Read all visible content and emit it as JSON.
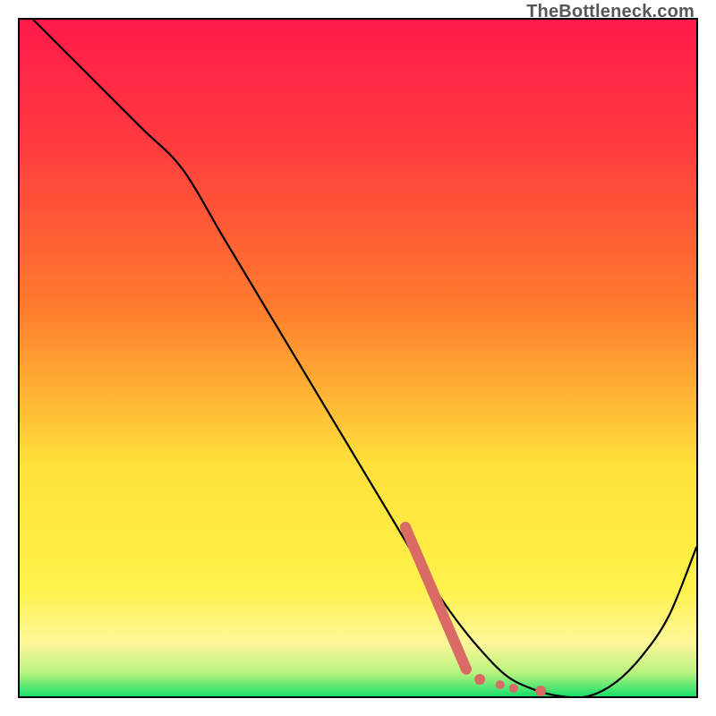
{
  "watermark": "TheBottleneck.com",
  "chart_data": {
    "type": "line",
    "title": "",
    "xlabel": "",
    "ylabel": "",
    "xlim": [
      0,
      100
    ],
    "ylim": [
      0,
      100
    ],
    "grid": false,
    "legend": false,
    "series": [
      {
        "name": "curve",
        "color": "#000000",
        "x": [
          0,
          4,
          10,
          18,
          24,
          30,
          36,
          42,
          48,
          54,
          60,
          64,
          68,
          72,
          76,
          80,
          84,
          88,
          92,
          96,
          100
        ],
        "y": [
          102,
          98,
          92,
          84,
          78,
          68,
          58,
          48,
          38,
          28,
          18,
          12,
          7,
          3,
          1,
          0,
          0,
          2,
          6,
          12,
          22
        ]
      }
    ],
    "highlight": {
      "color": "#d96a66",
      "segment_start": {
        "x": 57,
        "y": 25
      },
      "segment_end": {
        "x": 66,
        "y": 4
      },
      "dots": [
        {
          "x": 68,
          "y": 2.5
        },
        {
          "x": 71,
          "y": 1.7
        },
        {
          "x": 73,
          "y": 1.2
        },
        {
          "x": 77,
          "y": 0.8
        }
      ]
    },
    "background_gradient": {
      "top": "#ff1a4b",
      "mid1": "#ff7a2e",
      "mid2": "#ffe13a",
      "band": "#fef79a",
      "bottom": "#18e06b"
    }
  }
}
